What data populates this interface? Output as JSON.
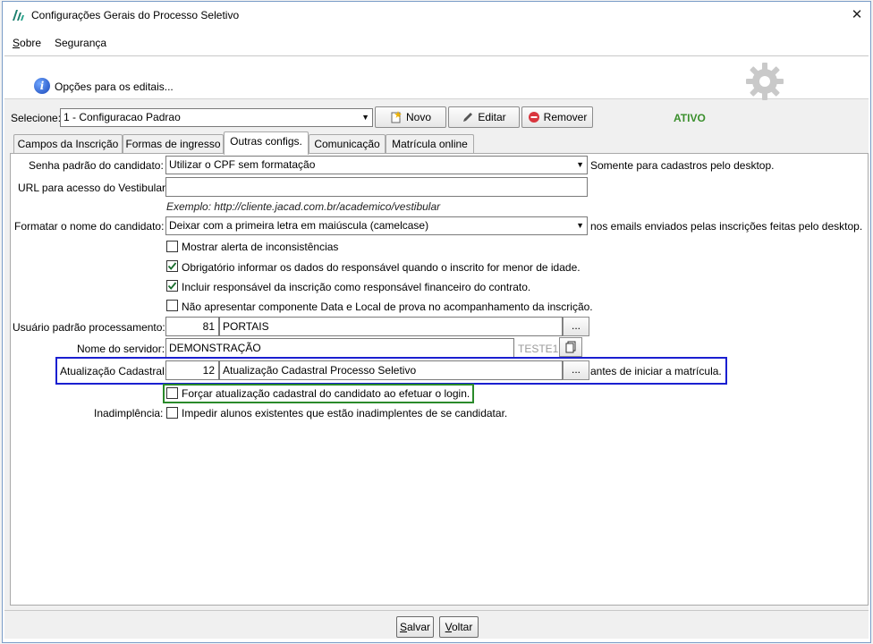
{
  "window": {
    "title": "Configurações Gerais do Processo Seletivo",
    "close_glyph": "✕"
  },
  "menu": {
    "items": [
      {
        "label": "Sobre",
        "accel": "S",
        "rest": "obre"
      },
      {
        "label": "Segurança",
        "accel": "",
        "rest": "Segurança"
      }
    ]
  },
  "header": {
    "info_text": "Opções para os editais...",
    "icon": "info-icon"
  },
  "selection": {
    "label": "Selecione:",
    "selected_value": "1 - Configuracao Padrao",
    "new_button": "Novo",
    "edit_button": "Editar",
    "remove_button": "Remover",
    "status": "ATIVO"
  },
  "tabs": [
    {
      "label": "Campos da Inscrição",
      "active": false
    },
    {
      "label": "Formas de ingresso",
      "active": false
    },
    {
      "label": "Outras configs.",
      "active": true
    },
    {
      "label": "Comunicação",
      "active": false
    },
    {
      "label": "Matrícula online",
      "active": false
    }
  ],
  "form": {
    "senha": {
      "label": "Senha padrão do candidato:",
      "value": "Utilizar o CPF sem formatação",
      "note": "Somente para cadastros pelo desktop."
    },
    "url": {
      "label": "URL para acesso do Vestibular:",
      "value": "",
      "example": "Exemplo: http://cliente.jacad.com.br/academico/vestibular"
    },
    "formatar": {
      "label": "Formatar o nome do candidato:",
      "value": "Deixar com a primeira letra em maiúscula (camelcase)",
      "note": "nos emails enviados pelas inscrições feitas pelo desktop."
    },
    "checks": [
      {
        "label": "Mostrar alerta de inconsistências",
        "checked": false
      },
      {
        "label": "Obrigatório informar os dados do responsável quando o inscrito for menor de idade.",
        "checked": true
      },
      {
        "label": "Incluir responsável da inscrição como responsável financeiro do contrato.",
        "checked": true
      },
      {
        "label": "Não apresentar componente Data e Local de prova no acompanhamento da inscrição.",
        "checked": false
      }
    ],
    "usuario": {
      "label": "Usuário padrão processamento:",
      "code": "81",
      "name": "PORTAIS",
      "lookup": "..."
    },
    "servidor": {
      "label": "Nome do servidor:",
      "value": "DEMONSTRAÇÃO",
      "suffix": "TESTE1"
    },
    "atualizacao": {
      "label": "Atualização Cadastral:",
      "code": "12",
      "name": "Atualização Cadastral Processo Seletivo",
      "lookup": "...",
      "note": "antes de iniciar a matrícula."
    },
    "forcar": {
      "label": "Forçar atualização cadastral do candidato ao efetuar o login.",
      "checked": false
    },
    "inadimplencia": {
      "label": "Inadimplência:",
      "check_label": "Impedir alunos existentes que estão inadimplentes de se candidatar.",
      "checked": false
    }
  },
  "footer": {
    "save": {
      "label": "Salvar",
      "accel": "S",
      "rest": "alvar"
    },
    "back": {
      "label": "Voltar",
      "accel": "V",
      "rest": "oltar"
    }
  },
  "colors": {
    "status": "#3a8f2c",
    "highlight_blue": "#1a1fd0",
    "highlight_green": "#2a8a2a",
    "check_mark": "#1a6e2e"
  }
}
